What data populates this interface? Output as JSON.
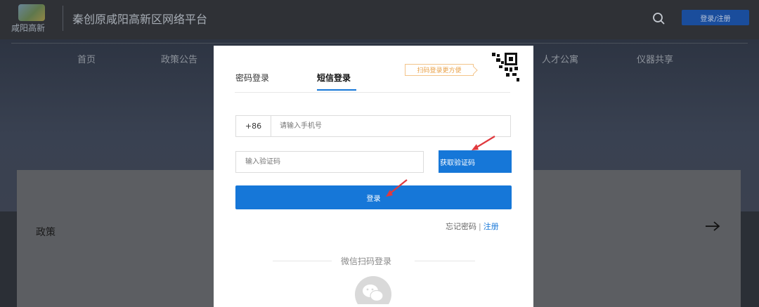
{
  "header": {
    "logo_text": "咸阳高新",
    "site_title": "秦创原咸阳高新区网络平台",
    "login_register": "登录/注册",
    "search_icon": "search-icon"
  },
  "nav": {
    "items": [
      "首页",
      "政策公告",
      "人才公寓",
      "仪器共享"
    ]
  },
  "section": {
    "label": "政策"
  },
  "modal": {
    "tabs": [
      {
        "label": "密码登录",
        "active": false
      },
      {
        "label": "短信登录",
        "active": true
      }
    ],
    "qr_hint": "扫码登录更方便",
    "country_code": "+86",
    "phone_placeholder": "请输入手机号",
    "code_placeholder": "输入验证码",
    "get_code": "获取验证码",
    "submit": "登录",
    "forgot": "忘记密码",
    "separator": "|",
    "register": "注册",
    "wechat_label": "微信扫码登录"
  },
  "colors": {
    "primary": "#1677d8",
    "hint_orange": "#e9a24a",
    "annotation_red": "#e0393e"
  }
}
